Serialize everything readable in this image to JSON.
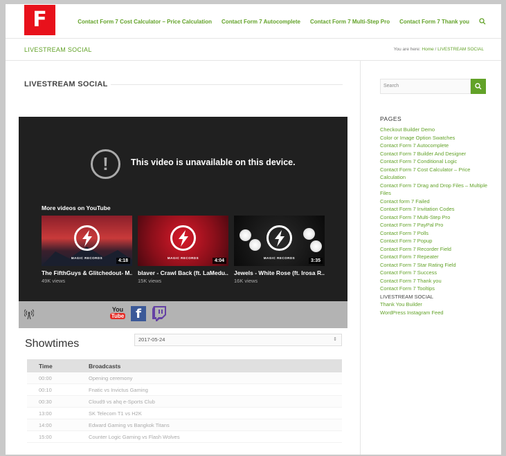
{
  "logo": {
    "letter": "F"
  },
  "nav": {
    "items": [
      "Contact Form 7 Cost Calculator – Price Calculation",
      "Contact Form 7 Autocomplete",
      "Contact Form 7 Multi-Step Pro",
      "Contact Form 7 Thank you"
    ]
  },
  "titlebar": {
    "title": "LIVESTREAM SOCIAL"
  },
  "breadcrumb": {
    "prefix": "You are here:",
    "home": "Home",
    "sep": "/",
    "current": "LIVESTREAM SOCIAL"
  },
  "main": {
    "heading": "LIVESTREAM SOCIAL"
  },
  "player": {
    "message": "This video is unavailable on this device.",
    "more_label": "More videos on YouTube",
    "brand": "MAGIC RECORDS",
    "videos": [
      {
        "title": "The FifthGuys & Glitchedout- M...",
        "views": "49K views",
        "duration": "4:18"
      },
      {
        "title": "blaver - Crawl Back (ft. LaMedu...",
        "views": "15K views",
        "duration": "4:04"
      },
      {
        "title": "Jewels - White Rose (ft. Irosa R...",
        "views": "16K views",
        "duration": "3:35"
      }
    ]
  },
  "social": {
    "youtube_top": "You",
    "youtube_bottom": "Tube",
    "facebook": "f"
  },
  "showtimes": {
    "title": "Showtimes",
    "date": "2017-05-24",
    "headers": [
      "Time",
      "Broadcasts"
    ],
    "rows": [
      [
        "00:00",
        "Opening ceremony"
      ],
      [
        "00:10",
        "Fnatic vs Invictus Gaming"
      ],
      [
        "00:30",
        "Cloud9 vs ahq e-Sports Club"
      ],
      [
        "13:00",
        "SK Telecom T1 vs H2K"
      ],
      [
        "14:00",
        "Edward Gaming vs Bangkok Titans"
      ],
      [
        "15:00",
        "Counter Logic Gaming vs Flash Wolves"
      ]
    ]
  },
  "sidebar": {
    "search_placeholder": "Search",
    "pages_heading": "PAGES",
    "pages": [
      "Checkout Builder Demo",
      "Color or Image Option Swatches",
      "Contact Form 7 Autocomplete",
      "Contact Form 7 Builder And Designer",
      "Contact Form 7 Conditional Logic",
      "Contact Form 7 Cost Calculator – Price Calculation",
      "Contact Form 7 Drag and Drop Files – Multiple Files",
      "Contact form 7 Failed",
      "Contact Form 7 Invitation Codes",
      "Contact Form 7 Multi-Step Pro",
      "Contact Form 7 PayPal Pro",
      "Contact Form 7 Polls",
      "Contact Form 7 Popup",
      "Contact Form 7 Recorder Field",
      "Contact Form 7 Repeater",
      "Contact Form 7 Star Rating Field",
      "Contact Form 7 Success",
      "Contact Form 7 Thank you",
      "Contact Form 7 Tooltips",
      "LIVESTREAM SOCIAL",
      "Thank You Builder",
      "WordPress Instagram Feed"
    ],
    "current_page": "LIVESTREAM SOCIAL"
  },
  "colors": {
    "accent": "#62a228",
    "logo_bg": "#e8111b",
    "player_bg": "#202020"
  }
}
